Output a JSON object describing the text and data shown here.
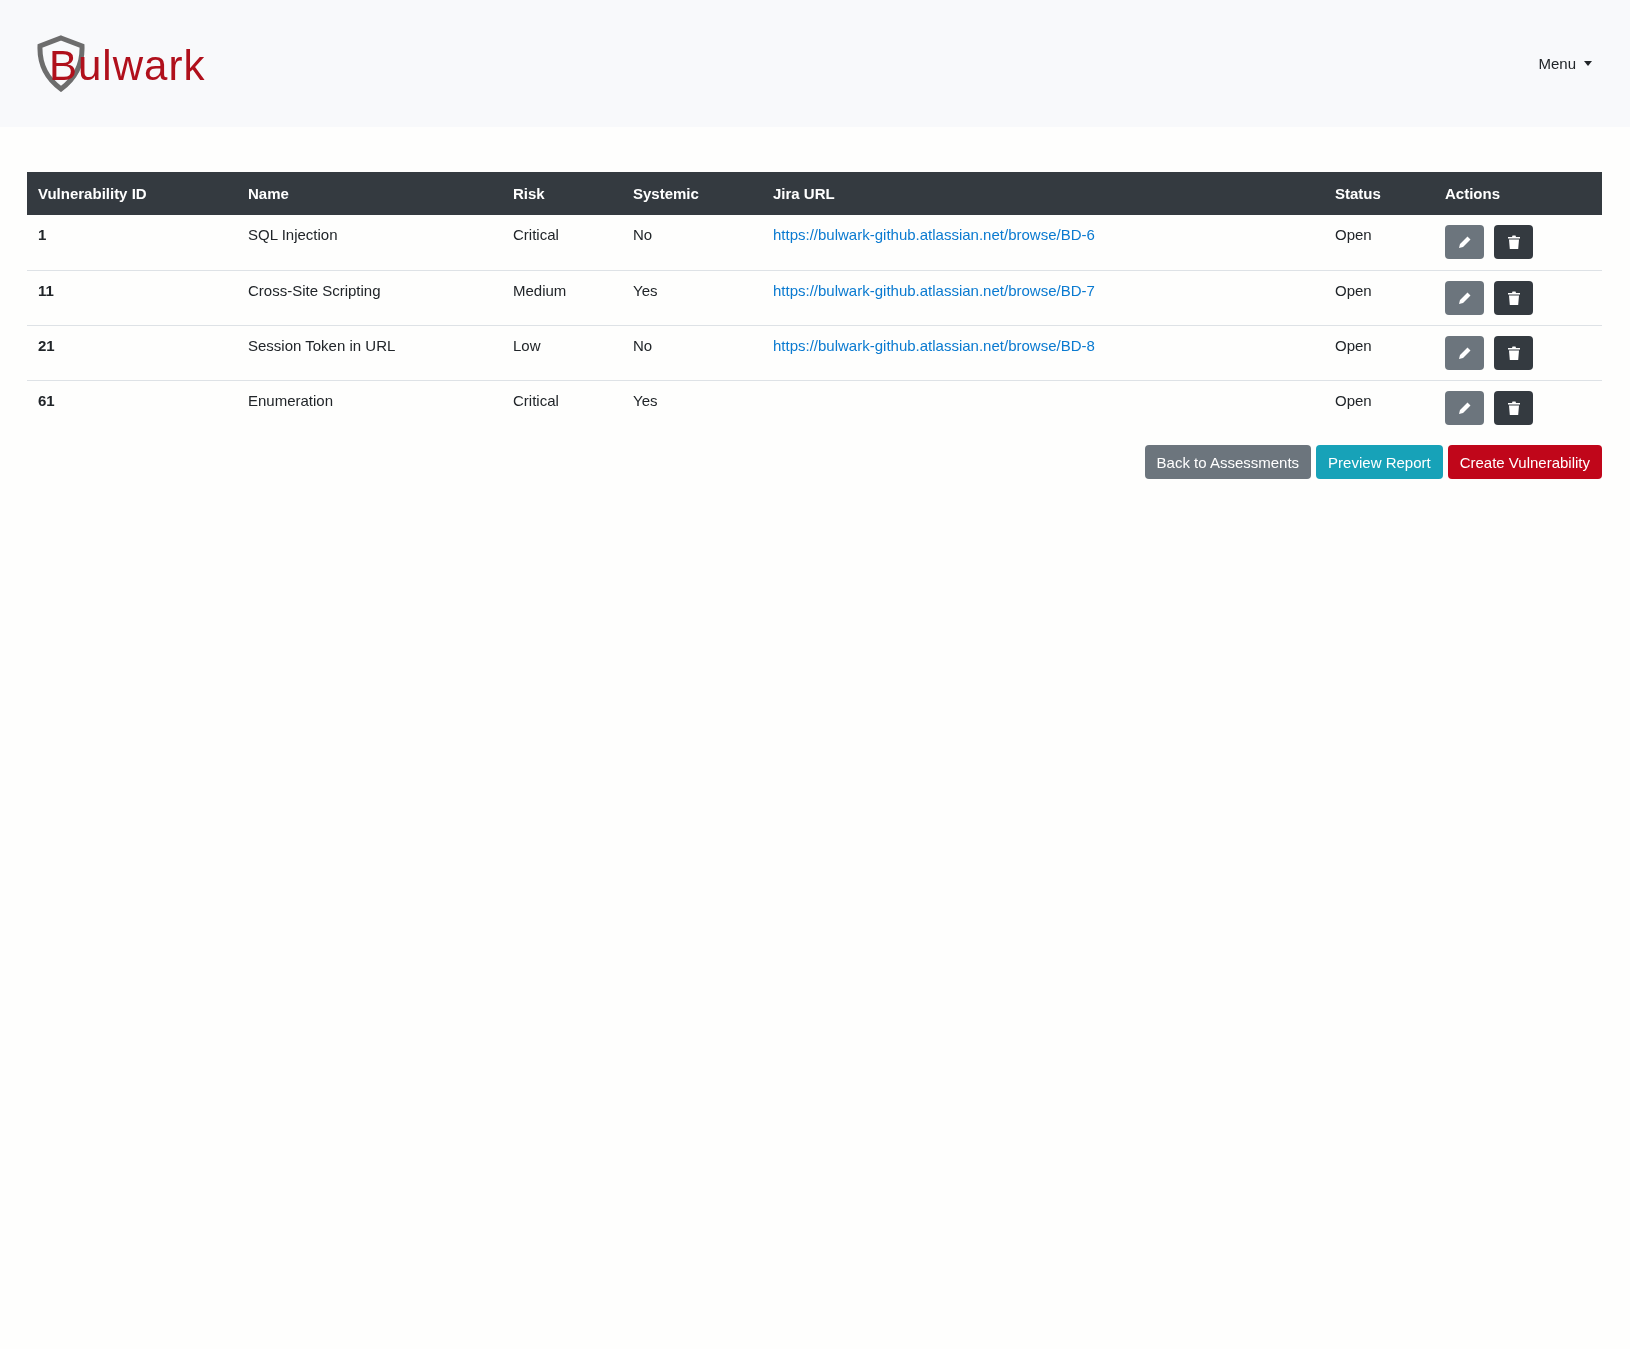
{
  "header": {
    "logo": "Bulwark",
    "menu": "Menu"
  },
  "table": {
    "columns": [
      "Vulnerability ID",
      "Name",
      "Risk",
      "Systemic",
      "Jira URL",
      "Status",
      "Actions"
    ],
    "rows": [
      {
        "id": "1",
        "name": "SQL Injection",
        "risk": "Critical",
        "systemic": "No",
        "jira_url": "https://bulwark-github.atlassian.net/browse/BD-6",
        "status": "Open"
      },
      {
        "id": "11",
        "name": "Cross-Site Scripting",
        "risk": "Medium",
        "systemic": "Yes",
        "jira_url": "https://bulwark-github.atlassian.net/browse/BD-7",
        "status": "Open"
      },
      {
        "id": "21",
        "name": "Session Token in URL",
        "risk": "Low",
        "systemic": "No",
        "jira_url": "https://bulwark-github.atlassian.net/browse/BD-8",
        "status": "Open"
      },
      {
        "id": "61",
        "name": "Enumeration",
        "risk": "Critical",
        "systemic": "Yes",
        "status": "Open"
      }
    ]
  },
  "buttons": [
    {
      "label": "Back to Assessments",
      "kind": "secondary"
    },
    {
      "label": "Preview Report",
      "kind": "info"
    },
    {
      "label": "Create Vulnerability",
      "kind": "danger"
    }
  ]
}
